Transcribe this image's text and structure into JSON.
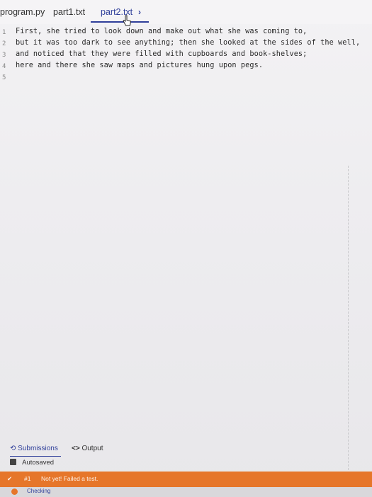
{
  "tabs": [
    {
      "label": "program.py"
    },
    {
      "label": "part1.txt"
    },
    {
      "label": "part2.txt"
    }
  ],
  "tab_overflow_icon": "chevron-right-icon",
  "editor": {
    "line_numbers": [
      "1",
      "2",
      "3",
      "4",
      "5"
    ],
    "lines": [
      "First, she tried to look down and make out what she was coming to,",
      "but it was too dark to see anything; then she looked at the sides of the well,",
      "and noticed that they were filled with cupboards and book-shelves;",
      "here and there she saw maps and pictures hung upon pegs.",
      ""
    ]
  },
  "panel": {
    "submissions_label": "Submissions",
    "output_label": "Output",
    "autosaved_label": "Autosaved",
    "test_result": {
      "number": "#1",
      "status": "Not yet! Failed a test."
    },
    "checking_label": "Checking"
  },
  "colors": {
    "accent": "#2f3f9a",
    "error": "#e6762a"
  }
}
